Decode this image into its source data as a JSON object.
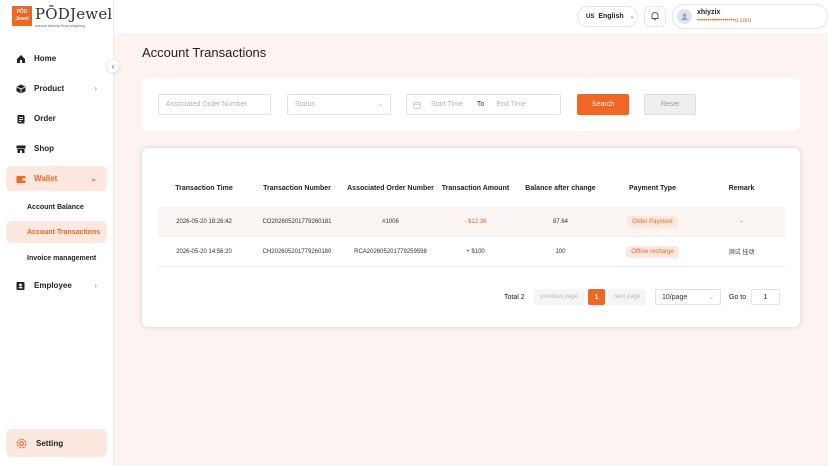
{
  "brand": {
    "logo_mark": "PŌD Jewel",
    "name": "PŌDJewel",
    "tagline": "source factory final shipping"
  },
  "sidebar": {
    "items": [
      {
        "label": "Home",
        "icon": "home-icon"
      },
      {
        "label": "Product",
        "icon": "cube-icon"
      },
      {
        "label": "Order",
        "icon": "clipboard-icon"
      },
      {
        "label": "Shop",
        "icon": "shop-icon"
      },
      {
        "label": "Wallet",
        "icon": "wallet-icon"
      },
      {
        "label": "Employee",
        "icon": "employee-icon"
      }
    ],
    "wallet_sub": [
      {
        "label": "Account Balance"
      },
      {
        "label": "Account Transactions"
      },
      {
        "label": "Invoice management"
      }
    ],
    "setting": "Setting"
  },
  "header": {
    "lang_code": "US",
    "language": "English",
    "user_name": "xhiyzix",
    "user_email": "••••••••••••••••••o.com"
  },
  "page": {
    "title": "Account Transactions"
  },
  "filters": {
    "order_placeholder": "Associated Order Number",
    "status_placeholder": "Status",
    "start_placeholder": "Start Time",
    "to": "To",
    "end_placeholder": "End Time",
    "search_label": "Search",
    "reset_label": "Reset"
  },
  "table": {
    "headers": [
      "Transaction Time",
      "Transaction Number",
      "Associated Order Number",
      "Transaction Amount",
      "Balance after change",
      "Payment Type",
      "Remark"
    ],
    "rows": [
      {
        "time": "2026-05-20 18:26:42",
        "number": "CO202605201779260181",
        "order": "#1006",
        "amount": "- $12.36",
        "balance": "87.64",
        "type": "Order Payment",
        "remark": "-"
      },
      {
        "time": "2026-05-20 14:56:20",
        "number": "CH202605201779260180",
        "order": "RCA202605201779259598",
        "amount": "+ $100",
        "balance": "100",
        "type": "Offline recharge",
        "remark": "测试 挂动"
      }
    ]
  },
  "pagination": {
    "total": "Total 2",
    "prev": "previous page",
    "current": "1",
    "next": "next page",
    "page_size": "10/page",
    "goto_label": "Go to",
    "goto_value": "1"
  },
  "colors": {
    "accent": "#f26522",
    "accent_light": "#fde8df",
    "background": "#fdf3f0"
  }
}
